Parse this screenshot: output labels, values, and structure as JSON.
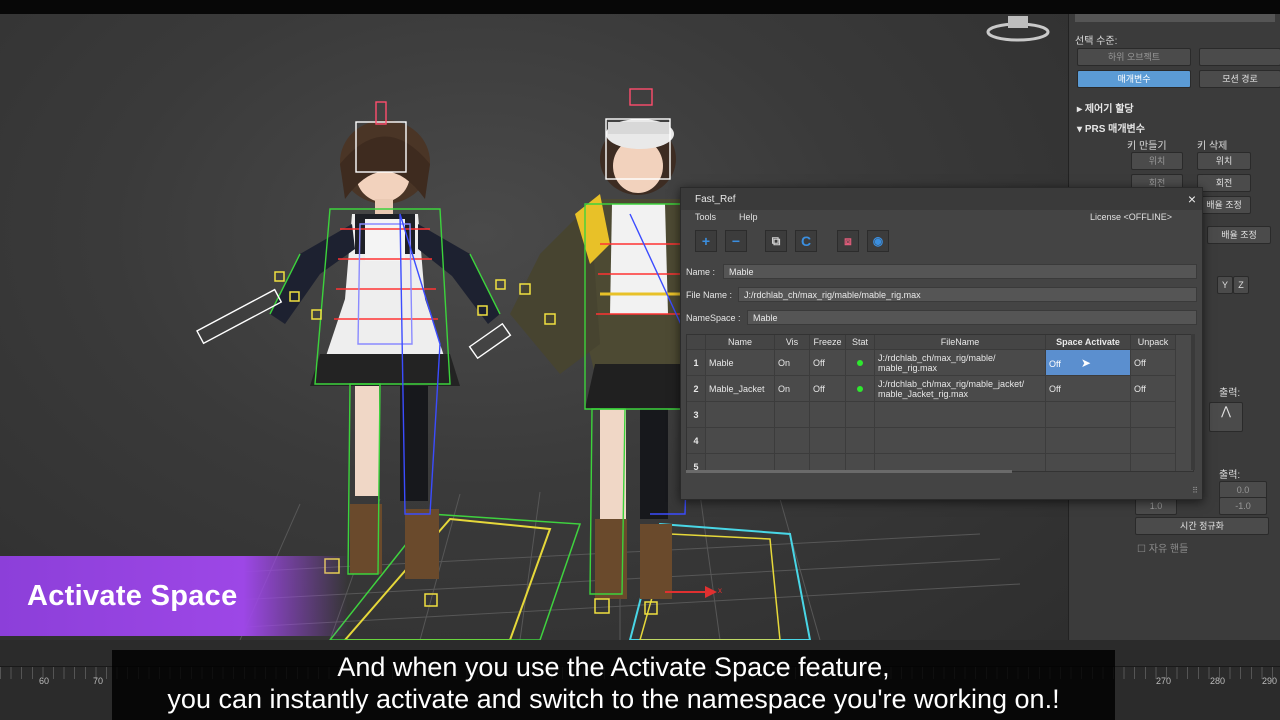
{
  "command_panel": {
    "title_cut": "",
    "selection_level_label": "선택 수준:",
    "sub_object_button": "하위 오브젝트",
    "params_button": "매개변수",
    "motion_path_button": "모션 경로",
    "assign_controller": "제어기 할당",
    "prs_params": "PRS 매개변수",
    "create_key": "키 만들기",
    "delete_key": "키 삭제",
    "position_disabled": "위치",
    "position": "위치",
    "rotation_disabled": "회전",
    "rotation": "회전",
    "scale_adjust": "배율 조정",
    "scale_adjust2": "배율 조정",
    "axis_y": "Y",
    "axis_z": "Z",
    "output_label": "출력:",
    "output_label2": "출력:",
    "value_a": "0.0",
    "value_b": "-1.0",
    "value_c": "1.0",
    "time_normalize": "시간 정규화",
    "free_handle": "자유 핸들"
  },
  "dialog": {
    "title": "Fast_Ref",
    "close_glyph": "×",
    "menu": [
      "Tools",
      "Help"
    ],
    "license": "License <OFFLINE>",
    "toolbar": [
      "+",
      "−",
      "⧉",
      "C",
      "⧈",
      "◉"
    ],
    "name_label": "Name :",
    "name_value": "Mable",
    "filename_label": "File Name :",
    "filename_value": "J:/rdchlab_ch/max_rig/mable/mable_rig.max",
    "namespace_label": "NameSpace :",
    "namespace_value": "Mable",
    "columns": [
      "",
      "Name",
      "Vis",
      "Freeze",
      "Stat",
      "FileName",
      "Space Activate",
      "Unpack"
    ],
    "rows": [
      {
        "num": "1",
        "name": "Mable",
        "vis": "On",
        "freeze": "Off",
        "file1": "J:/rdchlab_ch/max_rig/mable/",
        "file2": "mable_rig.max",
        "space": "Off",
        "unpack": "Off"
      },
      {
        "num": "2",
        "name": "Mable_Jacket",
        "vis": "On",
        "freeze": "Off",
        "file1": "J:/rdchlab_ch/max_rig/mable_jacket/",
        "file2": "mable_Jacket_rig.max",
        "space": "Off",
        "unpack": "Off"
      },
      {
        "num": "3",
        "name": "",
        "vis": "",
        "freeze": "",
        "file1": "",
        "file2": "",
        "space": "",
        "unpack": ""
      },
      {
        "num": "4",
        "name": "",
        "vis": "",
        "freeze": "",
        "file1": "",
        "file2": "",
        "space": "",
        "unpack": ""
      },
      {
        "num": "5",
        "name": "",
        "vis": "",
        "freeze": "",
        "file1": "",
        "file2": "",
        "space": "",
        "unpack": ""
      }
    ]
  },
  "timeline": {
    "ticks": [
      "60",
      "70",
      "270",
      "280",
      "290"
    ]
  },
  "banner": "Activate Space",
  "subtitle": {
    "line1": "And when you use the Activate Space feature,",
    "line2": "you can instantly activate and switch to the namespace you're working on.!"
  },
  "colors": {
    "accent_purple": "#9d47e6",
    "selection_blue": "#5b8fcf",
    "status_green": "#2ee82e"
  }
}
